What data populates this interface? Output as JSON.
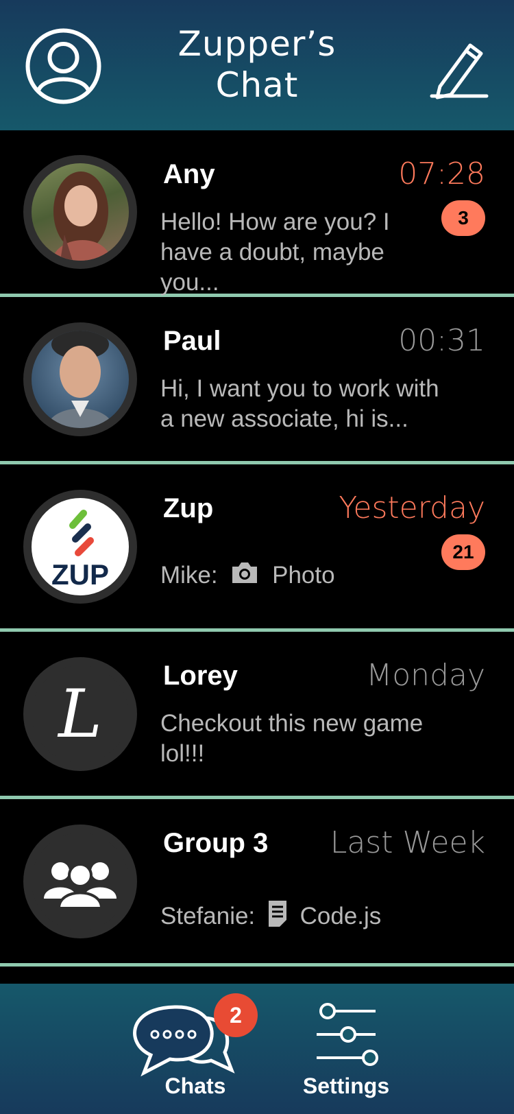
{
  "header": {
    "title_line1": "Zupper’s",
    "title_line2": "Chat",
    "profile_icon": "user-circle-icon",
    "compose_icon": "pencil-icon"
  },
  "chats": [
    {
      "name": "Any",
      "time": "07:28",
      "unread": true,
      "badge": "3",
      "message_line1": "Hello! How are you? I",
      "message_line2": "have a doubt, maybe you..."
    },
    {
      "name": "Paul",
      "time": "00:31",
      "unread": false,
      "message_line1": "Hi, I want you to work with",
      "message_line2": "a new associate, hi is..."
    },
    {
      "name": "Zup",
      "time": "Yesterday",
      "unread": true,
      "badge": "21",
      "sender": "Mike:",
      "attachment_icon": "camera-icon",
      "attachment_label": "Photo",
      "avatar_text": "ZUP"
    },
    {
      "name": "Lorey",
      "time": "Monday",
      "unread": false,
      "avatar_letter": "L",
      "message_line1": "Checkout this new game",
      "message_line2": "lol!!!"
    },
    {
      "name": "Group 3",
      "time": "Last Week",
      "unread": false,
      "sender": "Stefanie:",
      "attachment_icon": "document-icon",
      "attachment_label": "Code.js"
    }
  ],
  "tabs": {
    "chats_label": "Chats",
    "chats_badge": "2",
    "settings_label": "Settings"
  },
  "colors": {
    "accent_unread": "#ff7a5c",
    "divider": "#8fc9ae",
    "header_top": "#173a5c",
    "header_bottom": "#16586a",
    "tab_badge": "#e84b34"
  }
}
